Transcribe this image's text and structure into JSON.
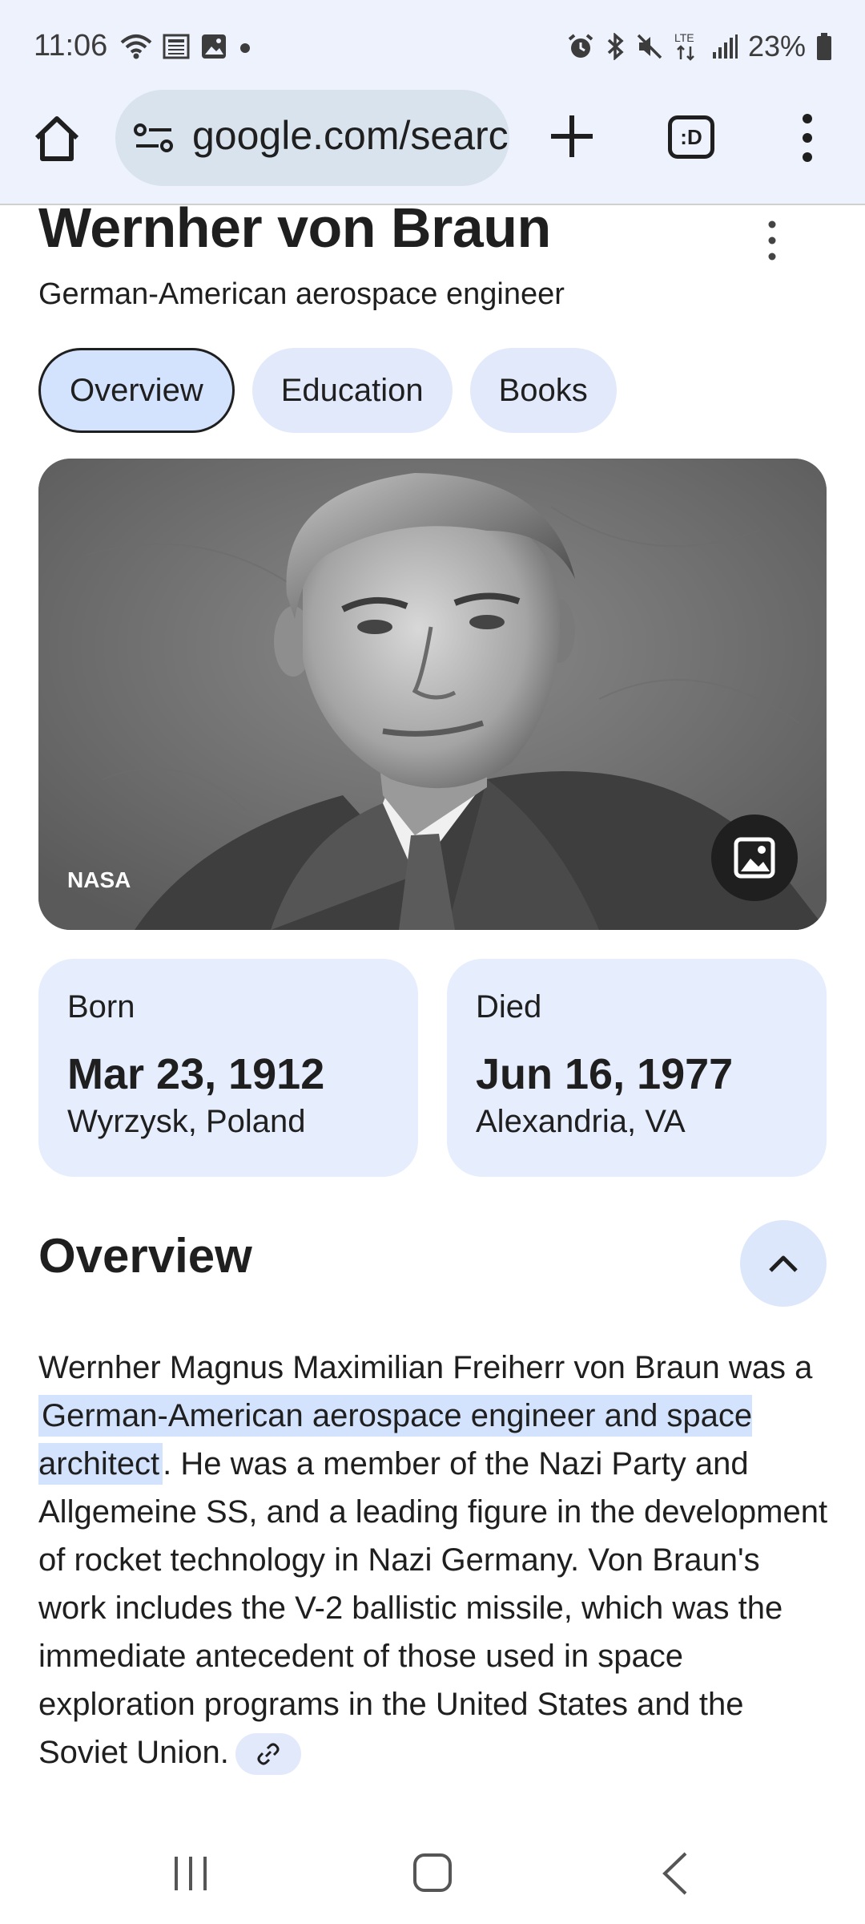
{
  "status_bar": {
    "time": "11:06",
    "network": "LTE",
    "battery": "23%"
  },
  "browser": {
    "url": "google.com/search",
    "tab_label": ":D"
  },
  "knowledge_panel": {
    "title": "Wernher von Braun",
    "subtitle": "German-American aerospace engineer",
    "chips": [
      {
        "label": "Overview",
        "active": true
      },
      {
        "label": "Education",
        "active": false
      },
      {
        "label": "Books",
        "active": false
      }
    ],
    "image": {
      "credit": "NASA",
      "button_icon": "image-icon"
    },
    "facts": {
      "born": {
        "label": "Born",
        "date": "Mar 23, 1912",
        "place": "Wyrzysk, Poland"
      },
      "died": {
        "label": "Died",
        "date": "Jun 16, 1977",
        "place": "Alexandria, VA"
      }
    },
    "overview": {
      "heading": "Overview",
      "text_before": "Wernher Magnus Maximilian Freiherr von Braun was a ",
      "highlight": "German-American aerospace engineer and space architect",
      "text_after": ". He was a member of the Nazi Party and Allgemeine SS, and a leading figure in the development of rocket technology in Nazi Germany. Von Braun's work includes the V-2 ballistic missile, which was the immediate antecedent of those used in space exploration programs in the United States and the Soviet Union."
    }
  },
  "colors": {
    "chrome_bg": "#eef2fc",
    "urlbar_bg": "#d8e3ee",
    "chip_bg": "#e1e9fb",
    "chip_active_bg": "#d3e3fd",
    "card_bg": "#e6edfd",
    "highlight_bg": "#d3e3fd"
  }
}
